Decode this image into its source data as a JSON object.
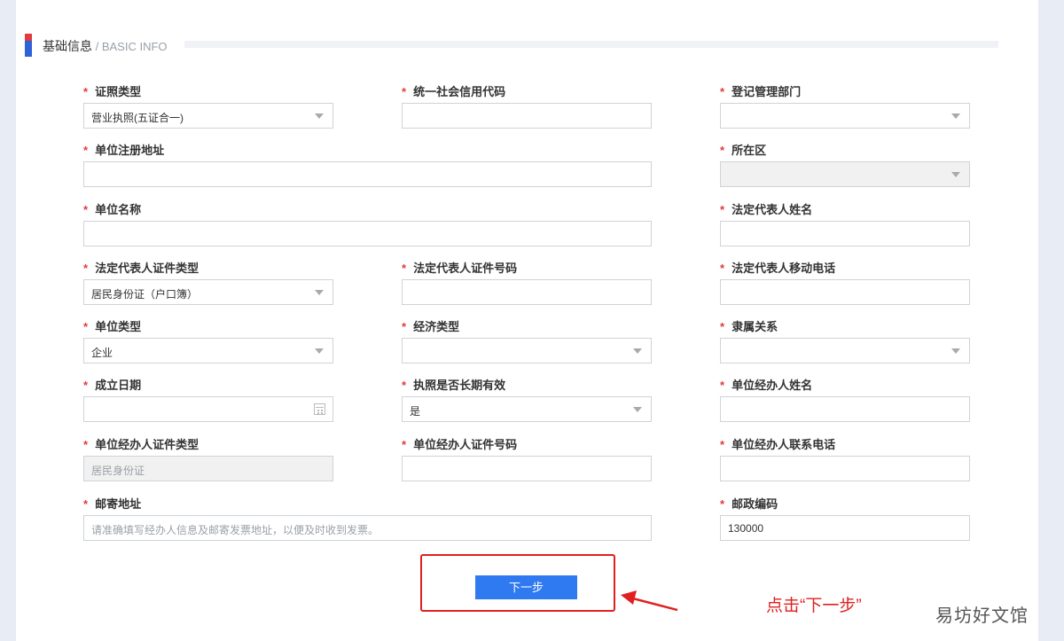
{
  "section": {
    "title": "基础信息",
    "subtitle": " / BASIC INFO"
  },
  "fields": {
    "cert_type": {
      "label": "证照类型",
      "value": "营业执照(五证合一)"
    },
    "credit_code": {
      "label": "统一社会信用代码",
      "value": ""
    },
    "reg_dept": {
      "label": "登记管理部门",
      "value": ""
    },
    "reg_address": {
      "label": "单位注册地址",
      "value": ""
    },
    "district": {
      "label": "所在区",
      "value": ""
    },
    "unit_name": {
      "label": "单位名称",
      "value": ""
    },
    "legal_rep_name": {
      "label": "法定代表人姓名",
      "value": ""
    },
    "legal_rep_id_type": {
      "label": "法定代表人证件类型",
      "value": "居民身份证（户口簿）"
    },
    "legal_rep_id_no": {
      "label": "法定代表人证件号码",
      "value": ""
    },
    "legal_rep_phone": {
      "label": "法定代表人移动电话",
      "value": ""
    },
    "unit_type": {
      "label": "单位类型",
      "value": "企业"
    },
    "economic_type": {
      "label": "经济类型",
      "value": ""
    },
    "affiliation": {
      "label": "隶属关系",
      "value": ""
    },
    "established_date": {
      "label": "成立日期",
      "value": ""
    },
    "license_long_term": {
      "label": "执照是否长期有效",
      "value": "是"
    },
    "agent_name": {
      "label": "单位经办人姓名",
      "value": ""
    },
    "agent_id_type": {
      "label": "单位经办人证件类型",
      "value": "居民身份证"
    },
    "agent_id_no": {
      "label": "单位经办人证件号码",
      "value": ""
    },
    "agent_phone": {
      "label": "单位经办人联系电话",
      "value": ""
    },
    "mail_address": {
      "label": "邮寄地址",
      "placeholder": "请准确填写经办人信息及邮寄发票地址，以便及时收到发票。"
    },
    "postal_code": {
      "label": "邮政编码",
      "value": "130000"
    }
  },
  "required_mark": "*",
  "next_button": {
    "label": "下一步"
  },
  "annotation": "点击“下一步”",
  "watermark": "易坊好文馆",
  "colors": {
    "accent": "#2f7af0",
    "required": "#e23b3b",
    "highlight": "#e02020"
  },
  "icons": {
    "dropdown": "chevron-down-icon",
    "calendar": "calendar-icon"
  }
}
